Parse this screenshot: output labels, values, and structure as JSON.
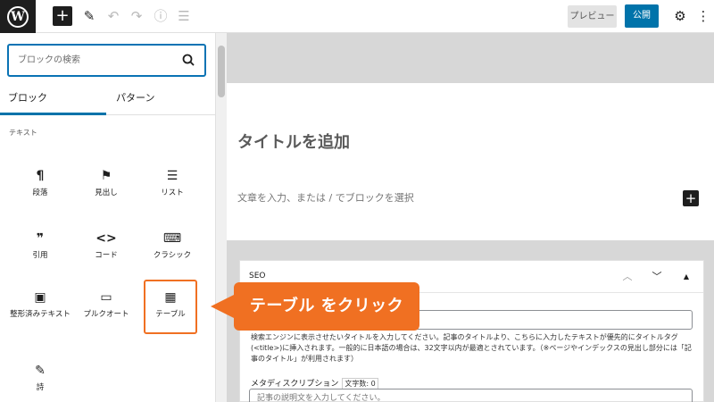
{
  "topbar": {
    "add_symbol": "+",
    "preview_label": "プレビュー",
    "publish_label": "公開",
    "icons": [
      "wordpress-logo",
      "plus-icon",
      "pencil-icon",
      "undo-icon",
      "redo-icon",
      "info-icon",
      "list-view-icon",
      "gear-icon",
      "more-vertical-icon"
    ]
  },
  "sidebar": {
    "search_placeholder": "ブロックの検索",
    "tabs": [
      "ブロック",
      "パターン"
    ],
    "category": "テキスト",
    "blocks": [
      {
        "label": "段落",
        "icon": "paragraph-icon",
        "glyph": "¶"
      },
      {
        "label": "見出し",
        "icon": "bookmark-icon",
        "glyph": "⚑"
      },
      {
        "label": "リスト",
        "icon": "list-icon",
        "glyph": "☰"
      },
      {
        "label": "引用",
        "icon": "quote-icon",
        "glyph": "❞"
      },
      {
        "label": "コード",
        "icon": "code-icon",
        "glyph": "<>"
      },
      {
        "label": "クラシック",
        "icon": "keyboard-icon",
        "glyph": "⌨"
      },
      {
        "label": "整形済みテキスト",
        "icon": "preformatted-icon",
        "glyph": "▣"
      },
      {
        "label": "プルクオート",
        "icon": "pullquote-icon",
        "glyph": "▭"
      },
      {
        "label": "テーブル",
        "icon": "table-icon",
        "glyph": "▦"
      },
      {
        "label": "詩",
        "icon": "verse-icon",
        "glyph": "✎"
      }
    ]
  },
  "editor": {
    "title_placeholder": "タイトルを追加",
    "paragraph_placeholder": "文章を入力、または / でブロックを選択",
    "inserter_symbol": "+"
  },
  "seo": {
    "title": "SEO",
    "description": "検索エンジンに表示させたいタイトルを入力してください。記事のタイトルより、こちらに入力したテキストが優先的にタイトルタグ(<title>)に挿入されます。一般的に日本語の場合は、32文字以内が最適とされています。（※ページやインデックスの見出し部分には「記事のタイトル」が利用されます）",
    "meta_label": "メタディスクリプション",
    "char_count": "文字数: 0",
    "meta_placeholder": "記事の説明文を入力してください。"
  },
  "callout": {
    "text": "テーブル をクリック",
    "color": "#f07022"
  }
}
